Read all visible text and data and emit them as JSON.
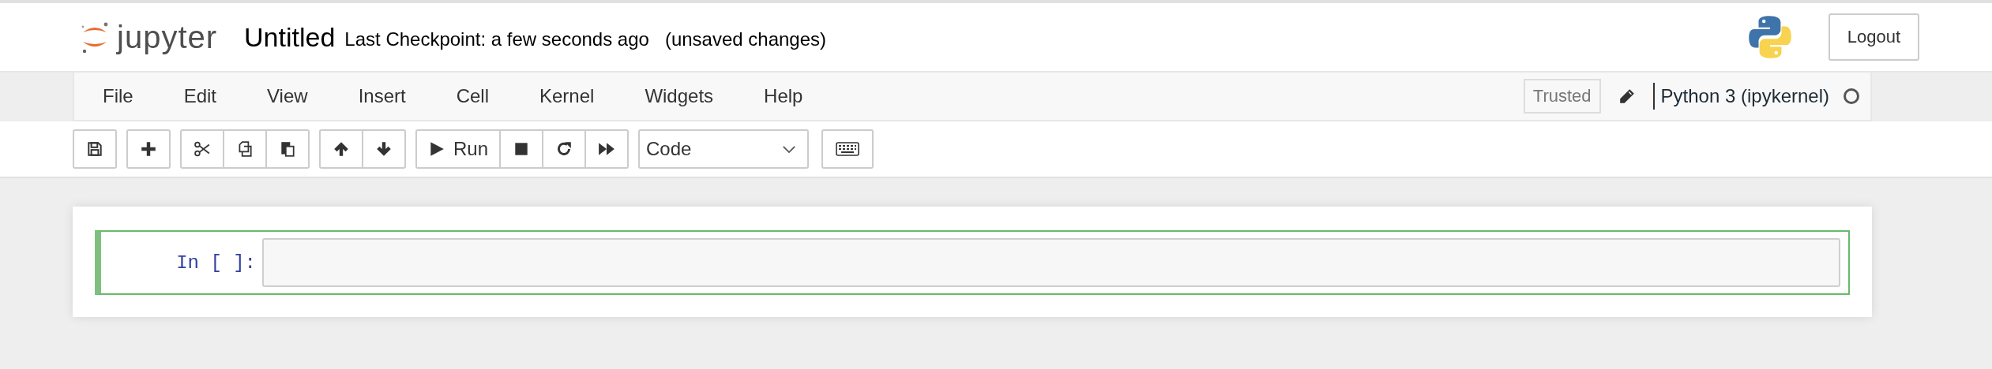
{
  "header": {
    "logo_text": "jupyter",
    "notebook_name": "Untitled",
    "checkpoint": "Last Checkpoint: a few seconds ago",
    "save_status": "(unsaved changes)",
    "logout": "Logout"
  },
  "menu": [
    {
      "label": "File"
    },
    {
      "label": "Edit"
    },
    {
      "label": "View"
    },
    {
      "label": "Insert"
    },
    {
      "label": "Cell"
    },
    {
      "label": "Kernel"
    },
    {
      "label": "Widgets"
    },
    {
      "label": "Help"
    }
  ],
  "notebook_status": {
    "trusted": "Trusted",
    "kernel_name": "Python 3 (ipykernel)",
    "kernel_busy": false
  },
  "toolbar": [
    [
      {
        "kind": "save"
      }
    ],
    [
      {
        "kind": "plus"
      }
    ],
    [
      {
        "kind": "cut"
      },
      {
        "kind": "copy"
      },
      {
        "kind": "paste"
      }
    ],
    [
      {
        "kind": "up"
      },
      {
        "kind": "down"
      }
    ],
    [
      {
        "kind": "run",
        "label": "Run"
      },
      {
        "kind": "stop"
      },
      {
        "kind": "restart"
      },
      {
        "kind": "fastforward"
      }
    ]
  ],
  "cell_type": "Code",
  "cells": [
    {
      "prompt": "In [ ]:",
      "selected": true
    }
  ]
}
